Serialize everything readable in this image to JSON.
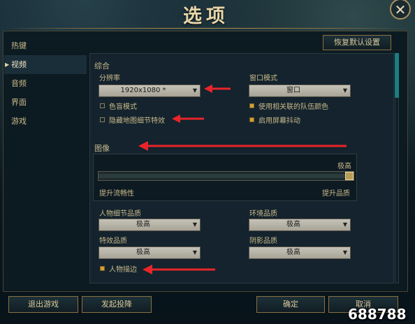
{
  "window": {
    "title": "选项",
    "close_glyph": "✕"
  },
  "sidebar": {
    "items": [
      {
        "label": "热键",
        "active": false
      },
      {
        "label": "视频",
        "active": true
      },
      {
        "label": "音频",
        "active": false
      },
      {
        "label": "界面",
        "active": false
      },
      {
        "label": "游戏",
        "active": false
      }
    ]
  },
  "restore_defaults_label": "恢复默认设置",
  "general": {
    "header": "综合",
    "resolution": {
      "label": "分辨率",
      "value": "1920x1080 *"
    },
    "window_mode": {
      "label": "窗口模式",
      "value": "窗口"
    },
    "checkboxes": {
      "colorblind": {
        "label": "色盲模式",
        "checked": false
      },
      "hide_map_details": {
        "label": "隐藏地图细节特效",
        "checked": false
      },
      "team_colors": {
        "label": "使用相关联的队伍颜色",
        "checked": true
      },
      "screen_shake": {
        "label": "启用屏幕抖动",
        "checked": true
      }
    }
  },
  "graphics": {
    "header": "图像",
    "slider": {
      "max_label": "极高",
      "left_label": "提升流畅性",
      "right_label": "提升品质",
      "level_fraction": 1.0
    },
    "character_quality": {
      "label": "人物细节品质",
      "value": "极高"
    },
    "environment_quality": {
      "label": "环境品质",
      "value": "极高"
    },
    "effects_quality": {
      "label": "特效品质",
      "value": "极高"
    },
    "shadow_quality": {
      "label": "阴影品质",
      "value": "极高"
    },
    "character_outline": {
      "label": "人物描边",
      "checked": true
    }
  },
  "footer": {
    "exit_game": "退出游戏",
    "surrender": "发起投降",
    "ok": "确定",
    "cancel": "取消"
  },
  "watermark_text": "688788",
  "icons": {
    "close": "close-icon",
    "chevron": "chevron-down-icon",
    "nav_arrow": "nav-arrow-icon"
  },
  "colors": {
    "accent_gold": "#c8b98a",
    "checkbox_on": "#d0a038",
    "annotation_arrow": "#e8252a",
    "scroll_thumb": "#1c7f80"
  }
}
